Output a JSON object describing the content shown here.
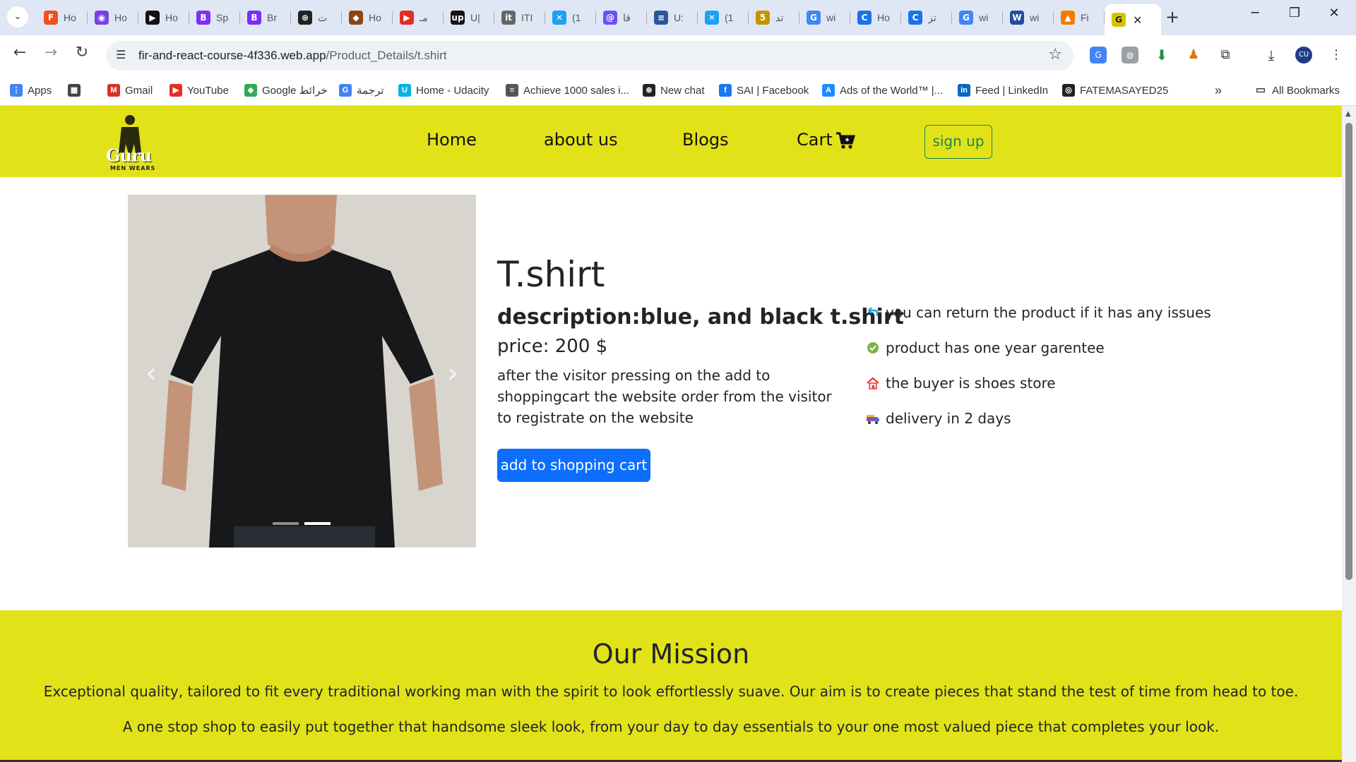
{
  "browser": {
    "tabs": [
      {
        "title": "Ho",
        "color": "#f24e1e",
        "glyph": "F"
      },
      {
        "title": "Ho",
        "color": "#7b3fe4",
        "glyph": "◉"
      },
      {
        "title": "Ho",
        "color": "#111111",
        "glyph": "▶"
      },
      {
        "title": "Sp",
        "color": "#7b2ff7",
        "glyph": "B"
      },
      {
        "title": "Br",
        "color": "#7b2ff7",
        "glyph": "B"
      },
      {
        "title": "ت",
        "color": "#222222",
        "glyph": "⊛"
      },
      {
        "title": "Ho",
        "color": "#8b4513",
        "glyph": "◆"
      },
      {
        "title": "مـ",
        "color": "#e52d27",
        "glyph": "▶"
      },
      {
        "title": "U|",
        "color": "#111111",
        "glyph": "up"
      },
      {
        "title": "ITI",
        "color": "#666666",
        "glyph": "it"
      },
      {
        "title": "(1",
        "color": "#1da1f2",
        "glyph": "✕"
      },
      {
        "title": "قا",
        "color": "#6c4ff7",
        "glyph": "@"
      },
      {
        "title": "U:",
        "color": "#2b5797",
        "glyph": "≡"
      },
      {
        "title": "(1",
        "color": "#1da1f2",
        "glyph": "✕"
      },
      {
        "title": "تد",
        "color": "#c79300",
        "glyph": "5"
      },
      {
        "title": "wi",
        "color": "#4285f4",
        "glyph": "G"
      },
      {
        "title": "Ho",
        "color": "#1a73e8",
        "glyph": "C"
      },
      {
        "title": "تز",
        "color": "#1a73e8",
        "glyph": "C"
      },
      {
        "title": "wi",
        "color": "#4285f4",
        "glyph": "G"
      },
      {
        "title": "wi",
        "color": "#1f4e9c",
        "glyph": "W"
      },
      {
        "title": "Fi",
        "color": "#f57c00",
        "glyph": "▲"
      }
    ],
    "active_tab_glyph": "G",
    "new_tab": "+",
    "window_controls": {
      "minimize": "─",
      "restore": "❐",
      "close": "✕"
    },
    "url_host": "fir-and-react-course-4f336.web.app",
    "url_path": "/Product_Details/t.shirt",
    "bookmarks": [
      {
        "label": "Apps",
        "color": "#4285f4",
        "glyph": "⋮"
      },
      {
        "label": "",
        "color": "#444444",
        "glyph": "▦"
      },
      {
        "label": "Gmail",
        "color": "#d93025",
        "glyph": "M"
      },
      {
        "label": "YouTube",
        "color": "#e52d27",
        "glyph": "▶"
      },
      {
        "label": "Google خرائط",
        "color": "#34a853",
        "glyph": "◆"
      },
      {
        "label": "ترجمة",
        "color": "#4285f4",
        "glyph": "G"
      },
      {
        "label": "Home - Udacity",
        "color": "#02b3e4",
        "glyph": "U"
      },
      {
        "label": "Achieve 1000 sales i...",
        "color": "#555555",
        "glyph": "≡"
      },
      {
        "label": "New chat",
        "color": "#222222",
        "glyph": "⊛"
      },
      {
        "label": "SAI | Facebook",
        "color": "#1877f2",
        "glyph": "f"
      },
      {
        "label": "Ads of the World™ |...",
        "color": "#1a8cff",
        "glyph": "A"
      },
      {
        "label": "Feed | LinkedIn",
        "color": "#0a66c2",
        "glyph": "in"
      },
      {
        "label": "FATEMASAYED25",
        "color": "#222222",
        "glyph": "◎"
      }
    ],
    "more_bookmarks": "»",
    "all_bookmarks": "All Bookmarks"
  },
  "site": {
    "logo_text": "Guru",
    "logo_sub": "MEN WEARS",
    "nav": {
      "home": "Home",
      "about": "about us",
      "blogs": "Blogs",
      "cart": "Cart",
      "signup": "sign up"
    }
  },
  "product": {
    "title": "T.shirt",
    "description": "description:blue, and black t.shirt",
    "price": "price: 200 $",
    "note": "after the visitor pressing on the add to shoppingcart the website order from the visitor to registrate on the website",
    "add_button": "add to shopping cart",
    "carousel_prev": "‹",
    "carousel_next": "›",
    "features": [
      "you can return the product if it has any issues",
      "product has one year garentee",
      "the buyer is shoes store",
      "delivery in 2 days"
    ]
  },
  "mission": {
    "title": "Our Mission",
    "p1": "Exceptional quality, tailored to fit every traditional working man with the spirit to look effortlessly suave. Our aim is to create pieces that stand the test of time from head to toe.",
    "p2": "A one stop shop to easily put together that handsome sleek look, from your day to day essentials to your one most valued piece that completes your look."
  }
}
